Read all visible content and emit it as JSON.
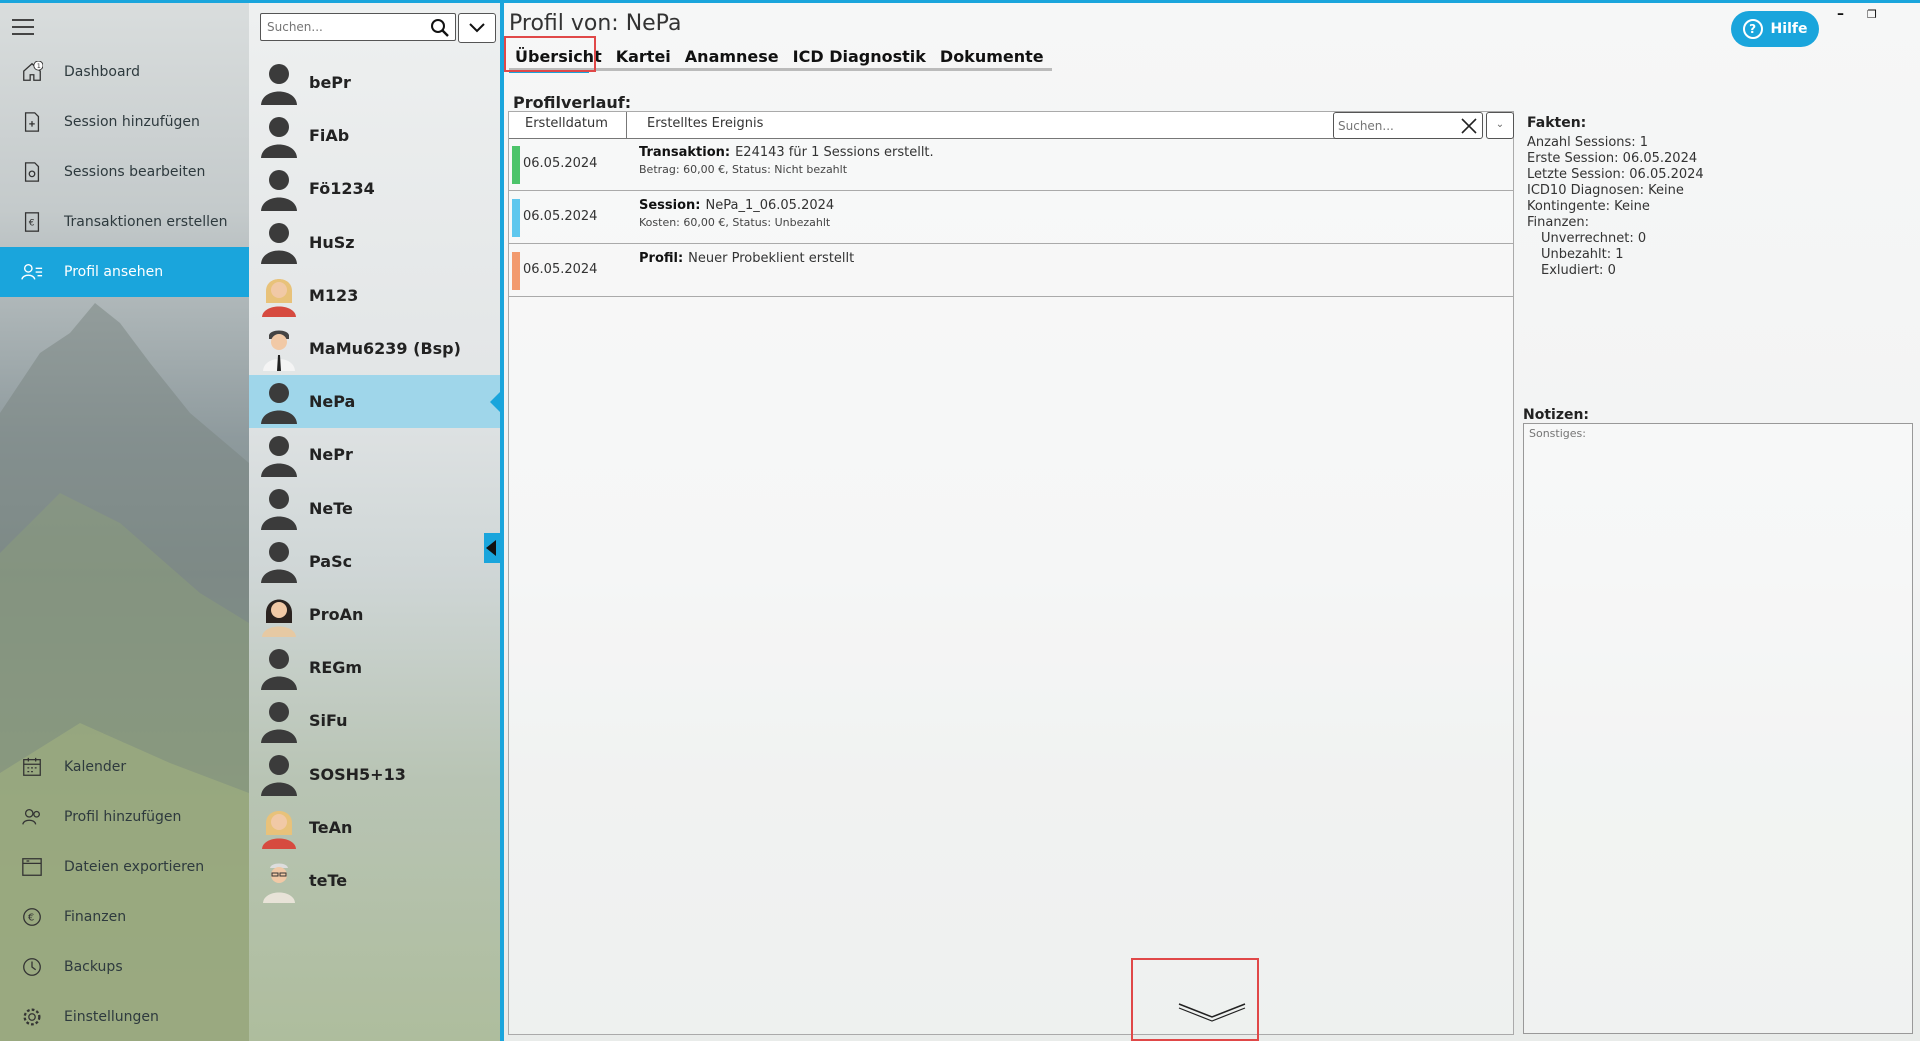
{
  "app": {
    "accent": "#1aa5dc"
  },
  "nav": {
    "items": [
      {
        "label": "Dashboard",
        "icon": "home-icon",
        "badge": "1"
      },
      {
        "label": "Session hinzufügen",
        "icon": "document-add-icon"
      },
      {
        "label": "Sessions bearbeiten",
        "icon": "document-edit-icon"
      },
      {
        "label": "Transaktionen erstellen",
        "icon": "euro-document-icon"
      },
      {
        "label": "Profil ansehen",
        "icon": "profile-list-icon",
        "active": true
      },
      {
        "label": "Kalender",
        "icon": "calendar-icon"
      },
      {
        "label": "Profil hinzufügen",
        "icon": "add-user-icon"
      },
      {
        "label": "Dateien exportieren",
        "icon": "export-icon"
      },
      {
        "label": "Finanzen",
        "icon": "euro-icon"
      },
      {
        "label": "Backups",
        "icon": "history-icon"
      },
      {
        "label": "Einstellungen",
        "icon": "gear-icon"
      }
    ]
  },
  "clients": {
    "search_placeholder": "Suchen...",
    "items": [
      {
        "name": "bePr",
        "avatar": "default"
      },
      {
        "name": "FiAb",
        "avatar": "default"
      },
      {
        "name": "Fö1234",
        "avatar": "default"
      },
      {
        "name": "HuSz",
        "avatar": "default"
      },
      {
        "name": "M123",
        "avatar": "woman-blonde"
      },
      {
        "name": "MaMu6239 (Bsp)",
        "avatar": "man-suit"
      },
      {
        "name": "NePa",
        "avatar": "default",
        "selected": true
      },
      {
        "name": "NePr",
        "avatar": "default"
      },
      {
        "name": "NeTe",
        "avatar": "default"
      },
      {
        "name": "PaSc",
        "avatar": "default"
      },
      {
        "name": "ProAn",
        "avatar": "woman-dark"
      },
      {
        "name": "REGm",
        "avatar": "default"
      },
      {
        "name": "SiFu",
        "avatar": "default"
      },
      {
        "name": "SOSH5+13",
        "avatar": "default"
      },
      {
        "name": "TeAn",
        "avatar": "woman-blonde"
      },
      {
        "name": "teTe",
        "avatar": "man-glasses"
      }
    ]
  },
  "main": {
    "title": "Profil von: NePa",
    "tabs": [
      "Übersicht",
      "Kartei",
      "Anamnese",
      "ICD Diagnostik",
      "Dokumente"
    ],
    "help_label": "Hilfe",
    "window_controls": {
      "minimize": "–",
      "restore": "❐"
    },
    "history": {
      "title": "Profilverlauf:",
      "col_date": "Erstelldatum",
      "col_event": "Erstelltes Ereignis",
      "search_placeholder": "Suchen...",
      "rows": [
        {
          "date": "06.05.2024",
          "color": "#4cc46a",
          "type": "Transaktion:",
          "text": "E24143 für 1 Sessions erstellt.",
          "sub": "Betrag: 60,00 €, Status: Nicht bezahlt"
        },
        {
          "date": "06.05.2024",
          "color": "#5ec7ee",
          "type": "Session:",
          "text": "NePa_1_06.05.2024",
          "sub": "Kosten: 60,00 €, Status: Unbezahlt"
        },
        {
          "date": "06.05.2024",
          "color": "#f29a6e",
          "type": "Profil:",
          "text": "Neuer Probeklient erstellt",
          "sub": ""
        }
      ]
    },
    "facts": {
      "title": "Fakten:",
      "lines": [
        "Anzahl Sessions: 1",
        "Erste Session: 06.05.2024",
        "Letzte Session: 06.05.2024",
        "ICD10 Diagnosen: Keine",
        "Kontingente: Keine",
        "Finanzen:",
        "Unverrechnet: 0",
        "Unbezahlt: 1",
        "Exludiert: 0"
      ]
    },
    "notes": {
      "title": "Notizen:",
      "placeholder": "Sonstiges:"
    }
  }
}
